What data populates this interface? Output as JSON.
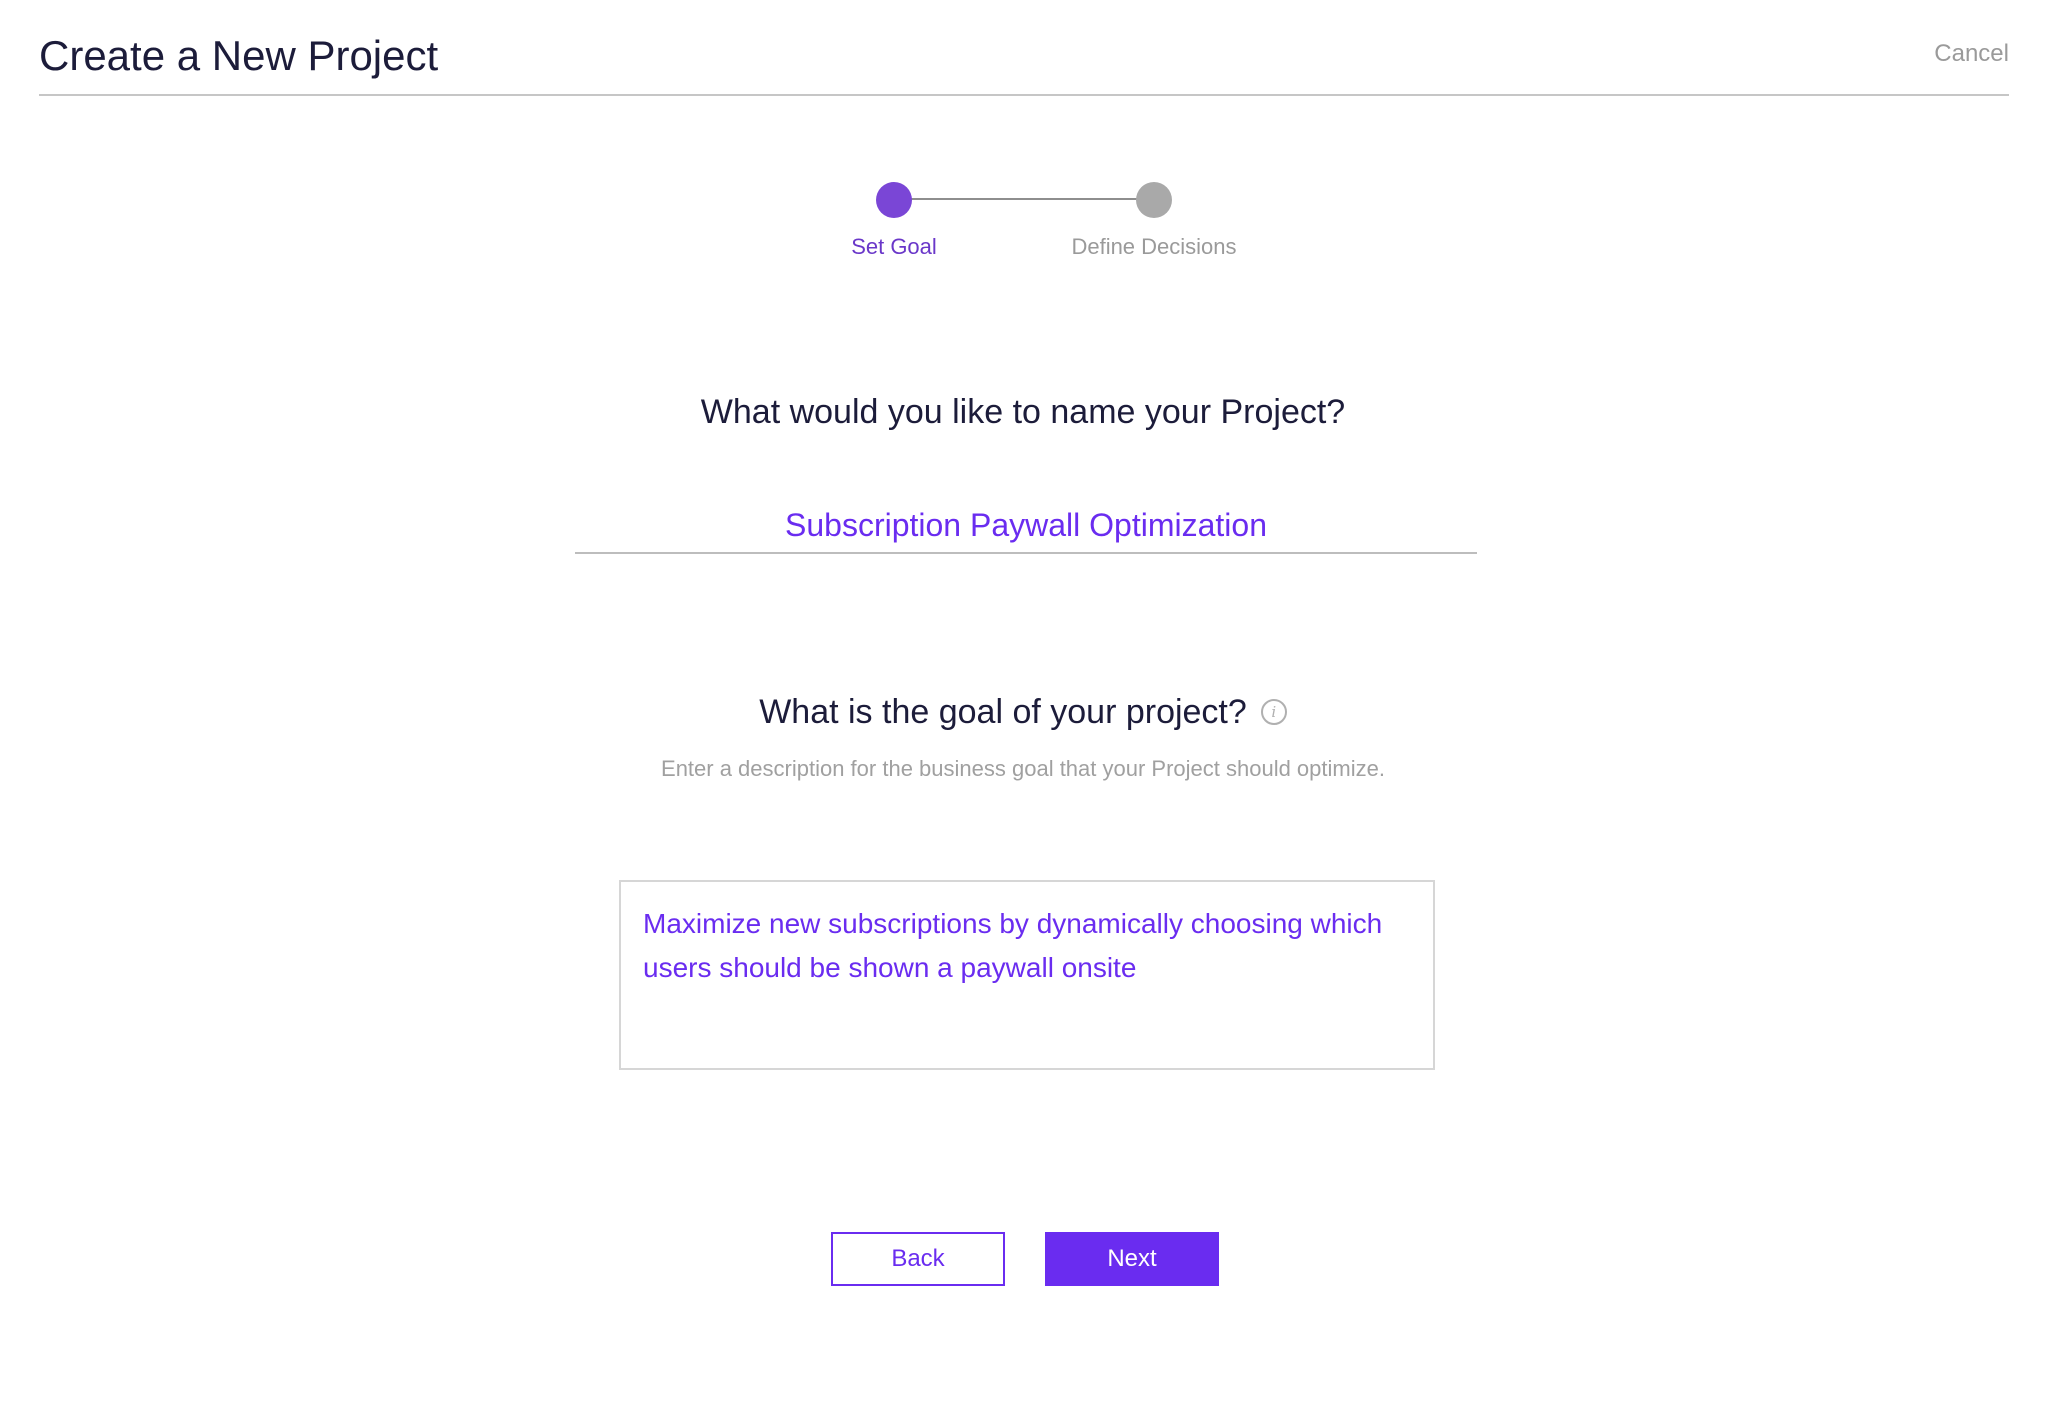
{
  "header": {
    "title": "Create a New Project",
    "cancel_label": "Cancel"
  },
  "stepper": {
    "steps": [
      {
        "label": "Set Goal",
        "state": "active"
      },
      {
        "label": "Define Decisions",
        "state": "inactive"
      }
    ]
  },
  "name_section": {
    "question": "What would you like to name your Project?",
    "input_value": "Subscription Paywall Optimization"
  },
  "goal_section": {
    "question": "What is the goal of your project?",
    "info_icon": "info-icon",
    "hint": "Enter a description for the business goal that your Project should optimize.",
    "textarea_value": "Maximize new subscriptions by dynamically choosing which users should be shown a paywall onsite"
  },
  "actions": {
    "back_label": "Back",
    "next_label": "Next"
  },
  "colors": {
    "accent": "#6a2cf0",
    "active_step": "#7a46d6",
    "inactive_step": "#a9a9a9",
    "heading": "#1c1c3a",
    "muted": "#9a9a9a"
  }
}
